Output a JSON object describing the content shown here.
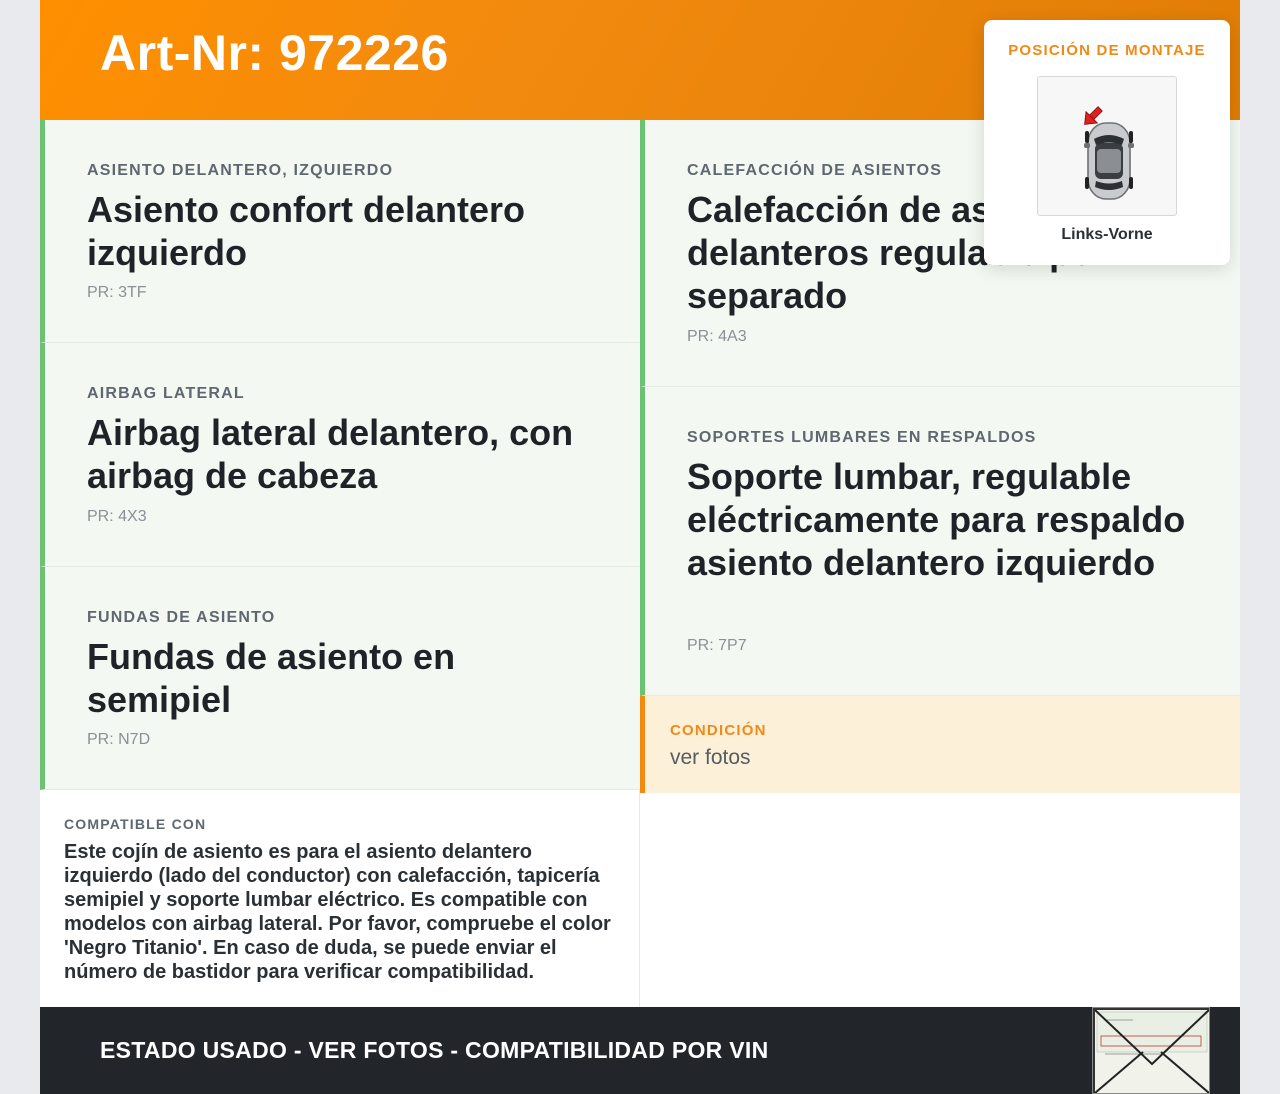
{
  "header": {
    "title": "Art-Nr: 972226"
  },
  "left_cards": [
    {
      "kicker": "ASIENTO DELANTERO, IZQUIERDO",
      "title": "Asiento confort delantero izquierdo",
      "pr": "PR: 3TF"
    },
    {
      "kicker": "AIRBAG LATERAL",
      "title": "Airbag lateral delantero, con airbag de cabeza",
      "pr": "PR: 4X3"
    },
    {
      "kicker": "FUNDAS DE ASIENTO",
      "title": "Fundas de asiento en semipiel",
      "pr": "PR: N7D"
    }
  ],
  "right_cards": [
    {
      "kicker": "CALEFACCIÓN DE ASIENTOS",
      "title": "Calefacción de asientos delanteros regulable por separado",
      "pr": "PR: 4A3"
    },
    {
      "kicker": "SOPORTES LUMBARES EN RESPALDOS",
      "title": "Soporte lumbar, regulable eléctricamente para respaldo asiento delantero izquierdo",
      "pr": "PR: 7P7"
    }
  ],
  "condition": {
    "kicker": "CONDICIÓN",
    "value": "ver fotos"
  },
  "compatible": {
    "kicker": "COMPATIBLE CON",
    "text": "Este cojín de asiento es para el asiento delantero izquierdo (lado del conductor) con calefacción, tapicería semipiel y soporte lumbar eléctrico. Es compatible con modelos con airbag lateral. Por favor, compruebe el color 'Negro Titanio'. En caso de duda, se puede enviar el número de bastidor para verificar compatibilidad."
  },
  "footer": {
    "text": "ESTADO USADO - VER FOTOS - COMPATIBILIDAD POR VIN"
  },
  "mount": {
    "kicker": "POSICIÓN DE MONTAJE",
    "label": "Links-Vorne"
  },
  "colors": {
    "orange": "#f28a0f",
    "green": "#6cc273",
    "dark": "#22252a",
    "card_bg": "#f3f9f2",
    "cond_bg": "#fdf0d9"
  }
}
